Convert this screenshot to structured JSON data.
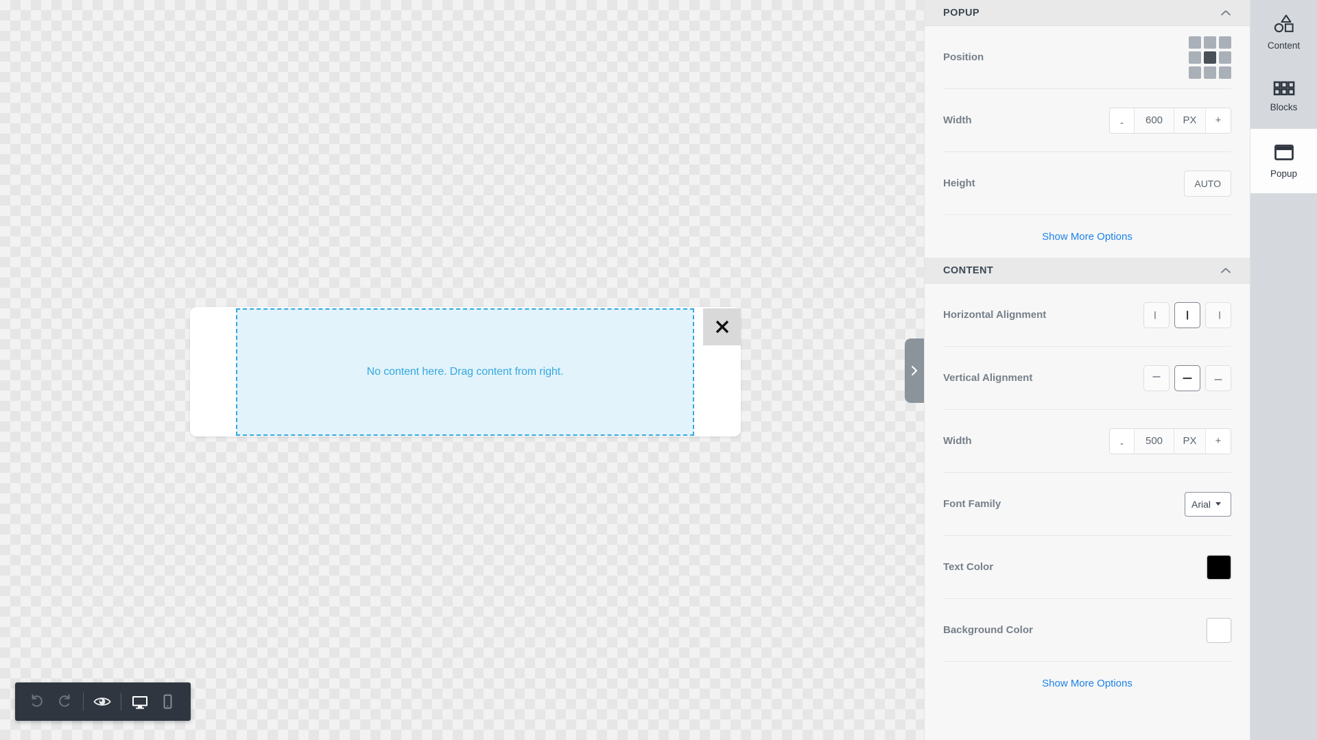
{
  "canvas": {
    "popup_preview": {
      "dropzone_text": "No content here. Drag content from right.",
      "close_icon": "close-x-icon",
      "background_color": "#ffffff",
      "dropzone_fill": "#e2f3fb",
      "dropzone_border": "#32a8e0"
    },
    "panel_handle_icon": "chevron-right-icon",
    "toolbar": {
      "undo_icon": "undo-arrow-icon",
      "redo_icon": "redo-arrow-icon",
      "preview_icon": "eye-preview-icon",
      "desktop_icon": "desktop-monitor-icon",
      "mobile_icon": "mobile-phone-icon",
      "background_color": "#2f3640",
      "active_device": "desktop"
    }
  },
  "settings_panel": {
    "sections": [
      {
        "title": "POPUP",
        "collapse_icon": "chevron-up-icon",
        "rows": [
          {
            "label": "Position",
            "type": "position-grid",
            "cells": [
              "top-left",
              "top-center",
              "top-right",
              "middle-left",
              "middle-center",
              "middle-right",
              "bottom-left",
              "bottom-center",
              "bottom-right"
            ],
            "selected_index": 4
          },
          {
            "label": "Width",
            "type": "stepper",
            "minus": "-",
            "value": "600",
            "unit": "PX",
            "plus": "+"
          },
          {
            "label": "Height",
            "type": "button",
            "value": "AUTO"
          }
        ],
        "more_options_label": "Show More Options"
      },
      {
        "title": "CONTENT",
        "collapse_icon": "chevron-up-icon",
        "rows": [
          {
            "label": "Horizontal Alignment",
            "type": "align-horizontal",
            "options": [
              "align-left",
              "align-center",
              "align-right"
            ],
            "selected_index": 1
          },
          {
            "label": "Vertical Alignment",
            "type": "align-vertical",
            "options": [
              "align-top",
              "align-middle",
              "align-bottom"
            ],
            "selected_index": 1
          },
          {
            "label": "Width",
            "type": "stepper",
            "minus": "-",
            "value": "500",
            "unit": "PX",
            "plus": "+"
          },
          {
            "label": "Font Family",
            "type": "select",
            "value": "Arial"
          },
          {
            "label": "Text Color",
            "type": "color",
            "value": "#000000"
          },
          {
            "label": "Background Color",
            "type": "color",
            "value": "#ffffff"
          }
        ],
        "more_options_label": "Show More Options"
      }
    ]
  },
  "icon_rail": {
    "items": [
      {
        "label": "Content",
        "icon": "shapes-content-icon",
        "active": false
      },
      {
        "label": "Blocks",
        "icon": "grid-blocks-icon",
        "active": false
      },
      {
        "label": "Popup",
        "icon": "popup-window-icon",
        "active": true
      }
    ]
  }
}
